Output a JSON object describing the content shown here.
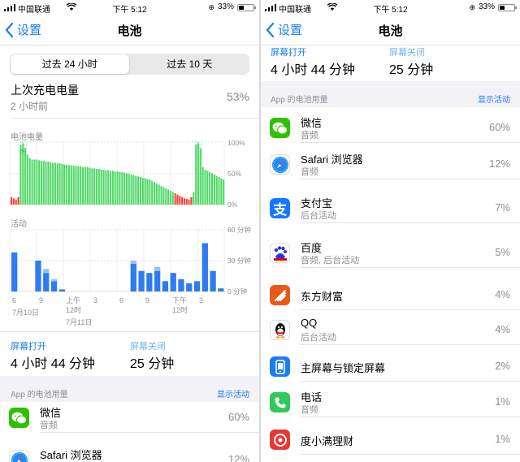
{
  "status_bar": {
    "carrier": "中国联通",
    "time": "下午 5:12",
    "battery_pct": "33%"
  },
  "nav": {
    "back_label": "设置",
    "title": "电池"
  },
  "segmented": {
    "options": [
      "过去 24 小时",
      "过去 10 天"
    ],
    "selected": 0
  },
  "last_charge": {
    "label": "上次充电电量",
    "ago": "2 小时前",
    "pct": "53%"
  },
  "battery_chart": {
    "label": "电池电量",
    "y_ticks": [
      "100%",
      "50%",
      "0%"
    ]
  },
  "activity_chart": {
    "label": "活动",
    "y_ticks": [
      "60 分钟",
      "30 分钟",
      "0 分钟"
    ]
  },
  "x_axis": {
    "left": [
      {
        "line1": "6",
        "line2": "7月10日"
      },
      {
        "line1": "9",
        "line2": ""
      },
      {
        "line1": "上午",
        "line2": "12时"
      },
      {
        "line1": "3",
        "line2": ""
      },
      {
        "line1": "6",
        "line2": ""
      },
      {
        "line1": "9",
        "line2": ""
      },
      {
        "line1": "下午",
        "line2": "12时"
      },
      {
        "line1": "3",
        "line2": ""
      }
    ],
    "date2": "7月11日"
  },
  "screen": {
    "on_label": "屏幕打开",
    "on_value": "4 小时 44 分钟",
    "off_label": "屏幕关闭",
    "off_value": "25 分钟"
  },
  "usage": {
    "header": "App 的电池用量",
    "show_activity": "显示活动"
  },
  "apps": [
    {
      "name": "微信",
      "sub": "音频",
      "pct": "60%",
      "icon": "wechat-icon"
    },
    {
      "name": "Safari 浏览器",
      "sub": "音频",
      "pct": "12%",
      "icon": "safari-icon"
    },
    {
      "name": "支付宝",
      "sub": "后台活动",
      "pct": "7%",
      "icon": "alipay-icon"
    },
    {
      "name": "百度",
      "sub": "音频, 后台活动",
      "pct": "5%",
      "icon": "baidu-icon"
    },
    {
      "name": "东方财富",
      "sub": "",
      "pct": "4%",
      "icon": "eastmoney-icon"
    },
    {
      "name": "QQ",
      "sub": "后台活动",
      "pct": "4%",
      "icon": "qq-icon"
    },
    {
      "name": "主屏幕与锁定屏幕",
      "sub": "",
      "pct": "2%",
      "icon": "home-lock-screen-icon"
    },
    {
      "name": "电话",
      "sub": "音频",
      "pct": "1%",
      "icon": "phone-icon"
    },
    {
      "name": "度小满理财",
      "sub": "",
      "pct": "1%",
      "icon": "duxiaoman-icon"
    }
  ],
  "colors": {
    "accent": "#1a7cf3",
    "battery_green": "#4cd964",
    "battery_low": "#ff3b30",
    "activity_dark": "#2f7bf0",
    "activity_light": "#8fc6f3"
  }
}
